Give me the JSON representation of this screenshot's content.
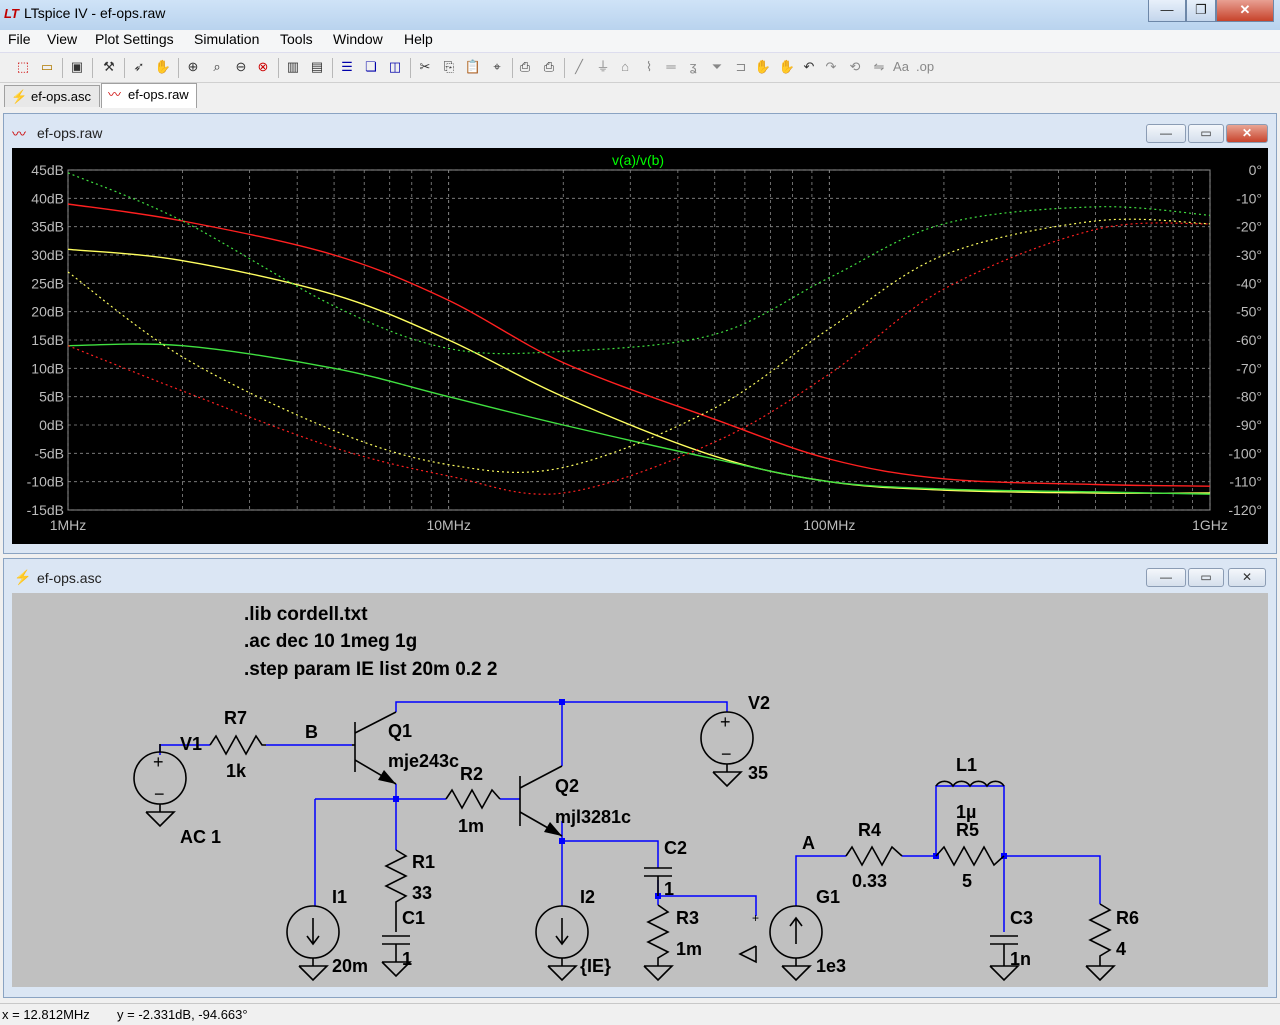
{
  "window": {
    "title": "LTspice IV - ef-ops.raw",
    "app_logo": "LT",
    "min": "—",
    "max": "❐",
    "close": "✕"
  },
  "menu": [
    "File",
    "View",
    "Plot Settings",
    "Simulation",
    "Tools",
    "Window",
    "Help"
  ],
  "tabs": [
    {
      "label": "ef-ops.asc",
      "icon": "schematic-icon"
    },
    {
      "label": "ef-ops.raw",
      "icon": "waveform-icon"
    }
  ],
  "plot_window": {
    "title": "ef-ops.raw"
  },
  "schematic_window": {
    "title": "ef-ops.asc"
  },
  "chart_data": {
    "type": "line",
    "title": "v(a)/v(b)",
    "x_scale": "log",
    "xlim": [
      1000000,
      1000000000
    ],
    "x_ticks": [
      "1MHz",
      "10MHz",
      "100MHz",
      "1GHz"
    ],
    "y_left_ticks": [
      "45dB",
      "40dB",
      "35dB",
      "30dB",
      "25dB",
      "20dB",
      "15dB",
      "10dB",
      "5dB",
      "0dB",
      "-5dB",
      "-10dB",
      "-15dB"
    ],
    "y_right_ticks": [
      "0°",
      "-10°",
      "-20°",
      "-30°",
      "-40°",
      "-50°",
      "-60°",
      "-70°",
      "-80°",
      "-90°",
      "-100°",
      "-110°",
      "-120°"
    ],
    "ylim_db": [
      -15,
      45
    ],
    "ylim_deg": [
      -120,
      0
    ],
    "grid": true,
    "series": [
      {
        "kind": "magnitude",
        "color": "#ff2020",
        "x": [
          1000000.0,
          2000000.0,
          5000000.0,
          10000000.0,
          20000000.0,
          50000000.0,
          100000000.0,
          200000000.0,
          500000000.0,
          1000000000.0
        ],
        "y_db": [
          39,
          36,
          30,
          22,
          11,
          1,
          -6,
          -9.5,
          -10.5,
          -10.8
        ]
      },
      {
        "kind": "magnitude",
        "color": "#ffff60",
        "x": [
          1000000.0,
          2000000.0,
          5000000.0,
          10000000.0,
          20000000.0,
          50000000.0,
          100000000.0,
          200000000.0,
          500000000.0,
          1000000000.0
        ],
        "y_db": [
          31,
          29,
          23,
          15,
          5,
          -5.5,
          -10,
          -11.5,
          -12,
          -12
        ]
      },
      {
        "kind": "magnitude",
        "color": "#40e040",
        "x": [
          1000000.0,
          2000000.0,
          5000000.0,
          10000000.0,
          20000000.0,
          50000000.0,
          100000000.0,
          200000000.0,
          500000000.0,
          1000000000.0
        ],
        "y_db": [
          14,
          14,
          10,
          5,
          0,
          -6,
          -10,
          -11.3,
          -11.8,
          -12.2
        ]
      },
      {
        "kind": "phase",
        "color": "#ff2020",
        "x": [
          1000000.0,
          2000000.0,
          5000000.0,
          10000000.0,
          20000000.0,
          50000000.0,
          100000000.0,
          200000000.0,
          500000000.0,
          1000000000.0
        ],
        "y_deg": [
          -62,
          -78,
          -98,
          -108,
          -114,
          -96,
          -72,
          -42,
          -21,
          -19
        ]
      },
      {
        "kind": "phase",
        "color": "#ffff60",
        "x": [
          1000000.0,
          2000000.0,
          5000000.0,
          10000000.0,
          20000000.0,
          50000000.0,
          100000000.0,
          200000000.0,
          500000000.0,
          1000000000.0
        ],
        "y_deg": [
          -36,
          -66,
          -92,
          -104,
          -105,
          -84,
          -56,
          -30,
          -18,
          -19
        ]
      },
      {
        "kind": "phase",
        "color": "#40e040",
        "x": [
          1000000.0,
          2000000.0,
          5000000.0,
          10000000.0,
          20000000.0,
          50000000.0,
          100000000.0,
          200000000.0,
          500000000.0,
          1000000000.0
        ],
        "y_deg": [
          -1,
          -18,
          -48,
          -63,
          -64,
          -58,
          -38,
          -19,
          -13,
          -16
        ]
      }
    ]
  },
  "schematic": {
    "directives": [
      ".lib cordell.txt",
      ".ac dec 10 1meg 1g",
      ".step param IE list 20m 0.2 2"
    ],
    "labels": {
      "R7": "R7",
      "R7v": "1k",
      "V1": "V1",
      "V1v": "AC 1",
      "B": "B",
      "Q1": "Q1",
      "Q1m": "mje243c",
      "R2": "R2",
      "R2v": "1m",
      "Q2": "Q2",
      "Q2m": "mjl3281c",
      "V2": "V2",
      "V2v": "35",
      "R1": "R1",
      "R1v": "33",
      "C1": "C1",
      "C1v": "1",
      "I1": "I1",
      "I1v": "20m",
      "I2": "I2",
      "I2v": "{IE}",
      "C2": "C2",
      "C2v": "1",
      "R3": "R3",
      "R3v": "1m",
      "A": "A",
      "R4": "R4",
      "R4v": "0.33",
      "G1": "G1",
      "G1v": "1e3",
      "L1": "L1",
      "L1v": "1µ",
      "R5": "R5",
      "R5v": "5",
      "C3": "C3",
      "C3v": "1n",
      "R6": "R6",
      "R6v": "4"
    }
  },
  "status": {
    "x": "x = 12.812MHz",
    "y": "y = -2.331dB, -94.663°"
  },
  "colors": {
    "plot_bg": "#000000",
    "wire": "#0000ff",
    "schematic_bg": "#c0c0c0",
    "trace_title": "#00ff00"
  }
}
